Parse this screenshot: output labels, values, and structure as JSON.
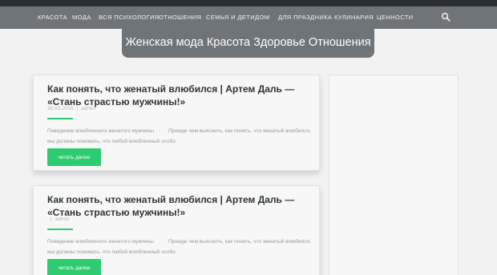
{
  "nav": {
    "items": [
      {
        "label": "красота"
      },
      {
        "label": "мода"
      },
      {
        "label": "вся психология"
      },
      {
        "label": "отношения"
      },
      {
        "label": "семья и дети"
      },
      {
        "label": "дом"
      },
      {
        "label": "для праздника"
      },
      {
        "label": "кулинария"
      },
      {
        "label": "ценности"
      }
    ],
    "search_icon": "search-icon"
  },
  "banner": {
    "title": "Женская мода Красота Здоровье Отношения"
  },
  "posts": [
    {
      "title": "Как понять, что женатый влюбился | Артем Даль — «Стань страстью мужчины!»",
      "date": "26.03.2018",
      "separator": "|",
      "author": "admin",
      "excerpt_a": "Поведение влюбленного женатого мужчины",
      "excerpt_b": "Прежде чем выяснить, как понять, что женатый влюбился, мы должны понимать, что любой влюбленный особо",
      "read_more": "читать далее"
    },
    {
      "title": "Как понять, что женатый влюбился | Артем Даль — «Стань страстью мужчины!»",
      "date": "",
      "separator": "|",
      "author": "admin",
      "excerpt_a": "Поведение влюбленного женатого мужчины",
      "excerpt_b": "Прежде чем выяснить, как понять, что женатый влюбился, мы должны понимать, что любой влюбленный особо",
      "read_more": "читать далее"
    }
  ],
  "colors": {
    "accent": "#2ecc71",
    "nav_bg": "#6f7478",
    "top_strip": "#2b2f33",
    "page_bg": "#f2f2f2"
  }
}
